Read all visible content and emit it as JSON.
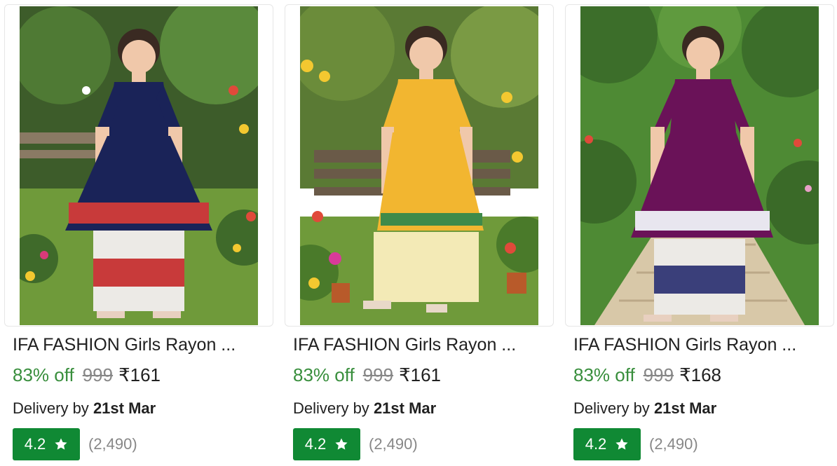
{
  "products": [
    {
      "title": "IFA FASHION Girls Rayon ...",
      "discount": "83% off",
      "mrp": "999",
      "price": "₹161",
      "delivery_prefix": "Delivery by",
      "delivery_date": "21st Mar",
      "rating": "4.2",
      "rating_count": "(2,490)",
      "image": {
        "alt": "Girl in navy blue embroidered kurta with printed palazzo in a flower garden",
        "dress_color": "#1a2358",
        "trim_color": "#c83a3a",
        "pants_color": "#eceae6"
      }
    },
    {
      "title": "IFA FASHION Girls Rayon ...",
      "discount": "83% off",
      "mrp": "999",
      "price": "₹161",
      "delivery_prefix": "Delivery by",
      "delivery_date": "21st Mar",
      "rating": "4.2",
      "rating_count": "(2,490)",
      "image": {
        "alt": "Girl in yellow embroidered kurta with yellow palazzo in a flower garden",
        "dress_color": "#f2b630",
        "trim_color": "#3f8a4a",
        "pants_color": "#f3eab6"
      }
    },
    {
      "title": "IFA FASHION Girls Rayon ...",
      "discount": "83% off",
      "mrp": "999",
      "price": "₹168",
      "delivery_prefix": "Delivery by",
      "delivery_date": "21st Mar",
      "rating": "4.2",
      "rating_count": "(2,490)",
      "image": {
        "alt": "Girl in purple embroidered kurta with printed palazzo on a garden path",
        "dress_color": "#6a1258",
        "trim_color": "#e8e6ef",
        "pants_color": "#eceae6"
      }
    }
  ],
  "colors": {
    "discount": "#388e3c",
    "mrp": "#878787",
    "rating_badge": "#108934",
    "text": "#212121"
  },
  "icons": {
    "rating": "star-icon"
  }
}
